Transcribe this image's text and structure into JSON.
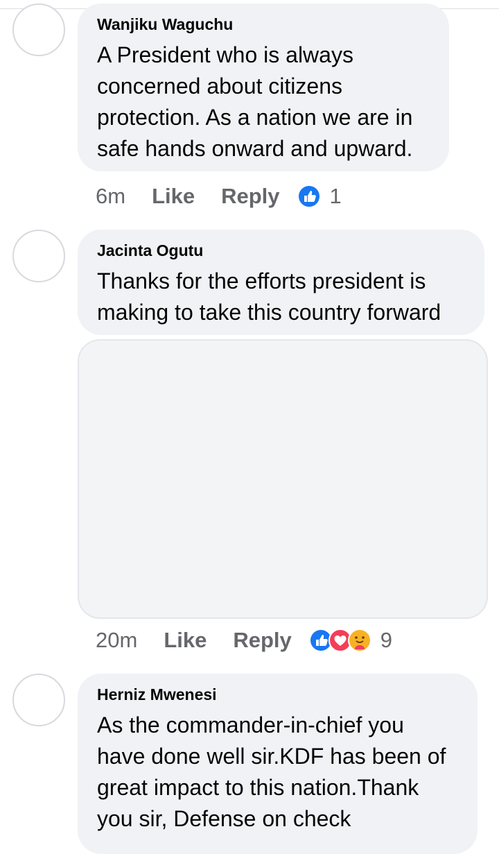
{
  "comments": [
    {
      "author": "Wanjiku Waguchu",
      "text": "A President who is always\nconcerned about citizens\nprotection. As a nation we are in\nsafe hands onward and upward.",
      "time": "6m",
      "like_label": "Like",
      "reply_label": "Reply",
      "reactions": [
        "like-icon"
      ],
      "reaction_count": "1"
    },
    {
      "author": "Jacinta Ogutu",
      "text": "Thanks for the efforts president is\nmaking to take this country forward",
      "time": "20m",
      "like_label": "Like",
      "reply_label": "Reply",
      "reactions": [
        "like-icon",
        "love-icon",
        "care-icon"
      ],
      "reaction_count": "9"
    },
    {
      "author": "Herniz Mwenesi",
      "text": "As the commander-in-chief you\nhave done well sir.KDF has been of\ngreat impact to this nation.Thank\nyou sir, Defense on check"
    }
  ],
  "colors": {
    "bubble": "#f0f2f5",
    "meta_text": "#65676b",
    "like_blue": "#1877f2",
    "love_red": "#f33e58",
    "care_yellow": "#f7b125"
  }
}
